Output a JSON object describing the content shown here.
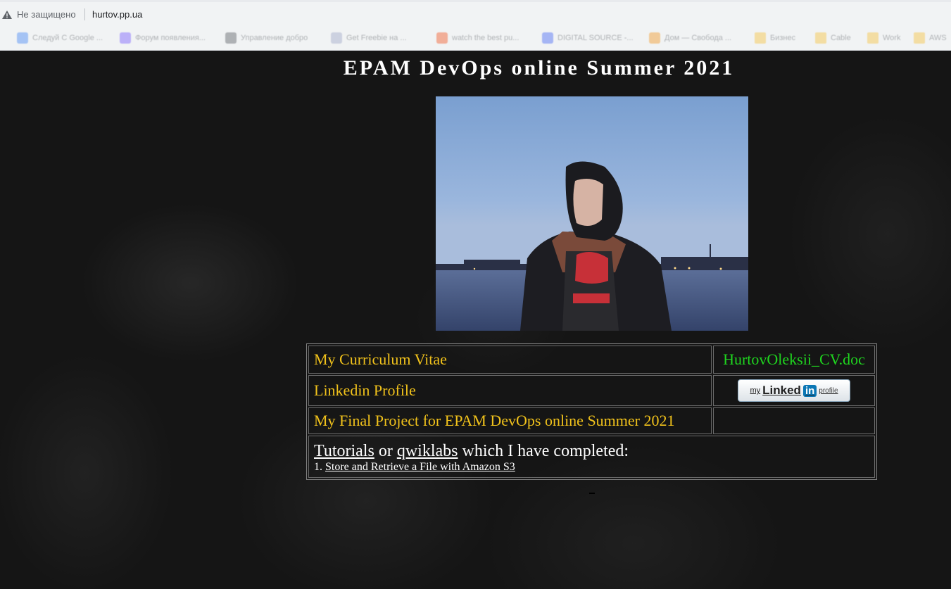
{
  "browser": {
    "security_text": "Не защищено",
    "url": "hurtov.pp.ua",
    "bookmarks": [
      {
        "label": "Следуй С Google ...",
        "color": "#4a8af4"
      },
      {
        "label": "Форум появления...",
        "color": "#7b61ff"
      },
      {
        "label": "Управление добро",
        "color": "#5f6368"
      },
      {
        "label": "Get Freebie на ...",
        "color": "#a0a8c8"
      },
      {
        "label": "watch the best pu...",
        "color": "#f25c2a"
      },
      {
        "label": "DIGITAL SOURCE -...",
        "color": "#4a6cf4"
      },
      {
        "label": "Дом — Свобода ...",
        "color": "#f29a2a"
      },
      {
        "label": "Бизнес",
        "color": "#f6c343"
      },
      {
        "label": "Cable",
        "color": "#f6c343"
      },
      {
        "label": "Work",
        "color": "#f6c343"
      },
      {
        "label": "AWS",
        "color": "#f6c343"
      }
    ]
  },
  "page": {
    "title": "EPAM DevOps online Summer 2021"
  },
  "table": {
    "cv_label": "My Curriculum Vitae",
    "cv_file": "HurtovOleksii_CV.doc",
    "linkedin_label": "Linkedin Profile",
    "linkedin_badge": {
      "my": "my",
      "linked": "Linked",
      "in": "in",
      "profile": "profile"
    },
    "project_label": "My Final Project for EPAM DevOps online Summer 2021",
    "tutorials_link": "Tutorials",
    "or_text": " or ",
    "qwiklabs_link": "qwiklabs",
    "completed_text": " which I have completed:",
    "item_number": "1. ",
    "item_1": "Store and Retrieve a File with Amazon S3"
  },
  "colors": {
    "gold_text": "#f1c21b",
    "green_link": "#1fd51f",
    "background": "#151515"
  }
}
